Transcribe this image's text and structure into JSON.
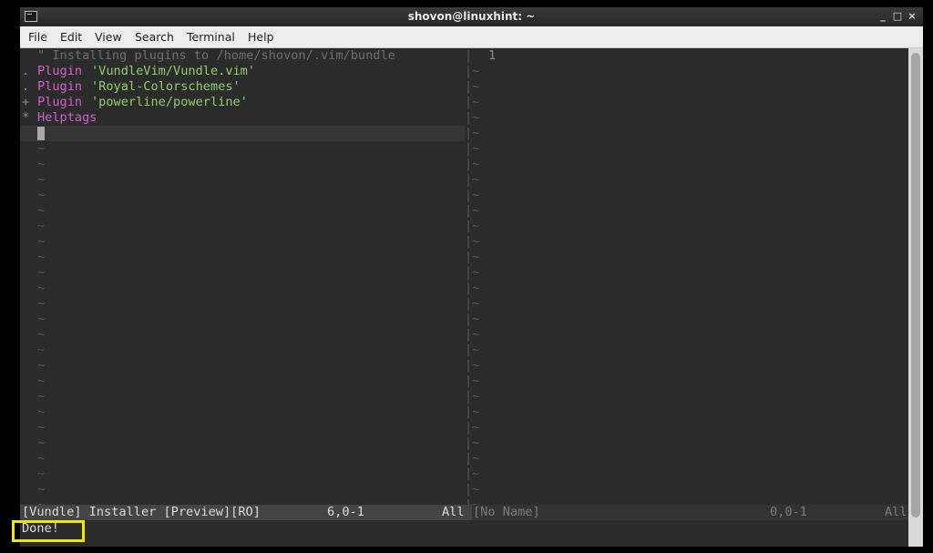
{
  "window": {
    "title": "shovon@linuxhint: ~",
    "minimize_glyph": "_",
    "maximize_glyph": "□",
    "close_glyph": "×"
  },
  "menu": {
    "items": [
      "File",
      "Edit",
      "View",
      "Search",
      "Terminal",
      "Help"
    ]
  },
  "left_pane": {
    "header_comment": "\" Installing plugins to /home/shovon/.vim/bundle",
    "plugins": [
      {
        "marker": ".",
        "keyword": "Plugin",
        "name": "'VundleVim/Vundle.vim'"
      },
      {
        "marker": ".",
        "keyword": "Plugin",
        "name": "'Royal-Colorschemes'"
      },
      {
        "marker": "+",
        "keyword": "Plugin",
        "name": "'powerline/powerline'"
      }
    ],
    "helptags": {
      "marker": "*",
      "label": "Helptags"
    },
    "tilde": "~"
  },
  "right_pane": {
    "line_number": "1",
    "tilde": "~",
    "separator": "|"
  },
  "status": {
    "left_name": "[Vundle] Installer [Preview][RO]",
    "left_position": "6,0-1",
    "left_scroll": "All",
    "right_name": "[No Name]",
    "right_position": "0,0-1",
    "right_scroll": "All"
  },
  "message": "Done!",
  "colors": {
    "keyword": "#d35fd0",
    "string": "#8fcf6a",
    "highlight_box": "#f3e600"
  }
}
